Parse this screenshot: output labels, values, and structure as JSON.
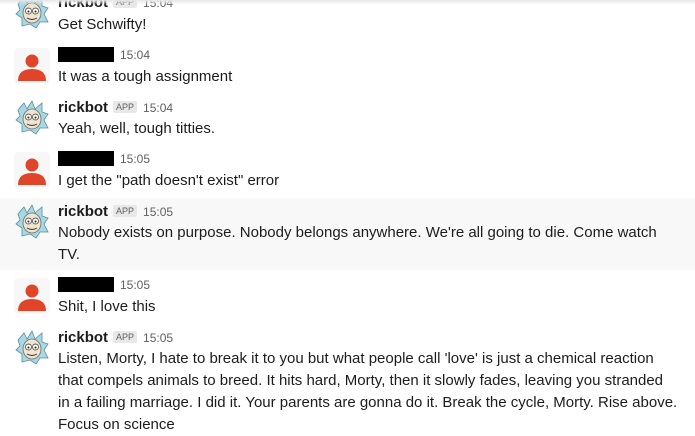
{
  "messages": [
    {
      "sender": "rickbot",
      "is_app": true,
      "badge": "APP",
      "time": "15:04",
      "text": "Get Schwifty!",
      "avatar": "rick-avatar"
    },
    {
      "sender": "",
      "redacted": true,
      "time": "15:04",
      "text": "It was a tough assignment",
      "avatar": "default-user-avatar"
    },
    {
      "sender": "rickbot",
      "is_app": true,
      "badge": "APP",
      "time": "15:04",
      "text": "Yeah, well, tough titties.",
      "avatar": "rick-avatar"
    },
    {
      "sender": "",
      "redacted": true,
      "time": "15:05",
      "text": "I get the \"path doesn't exist\" error",
      "avatar": "default-user-avatar"
    },
    {
      "sender": "rickbot",
      "is_app": true,
      "badge": "APP",
      "time": "15:05",
      "text": "Nobody exists on purpose. Nobody belongs anywhere. We're all going to die. Come watch TV.",
      "avatar": "rick-avatar",
      "hovered": true
    },
    {
      "sender": "",
      "redacted": true,
      "time": "15:05",
      "text": "Shit, I love this",
      "avatar": "default-user-avatar"
    },
    {
      "sender": "rickbot",
      "is_app": true,
      "badge": "APP",
      "time": "15:05",
      "text": "Listen, Morty, I hate to break it to you but what people call 'love' is just a chemical reaction that compels animals to breed. It hits hard, Morty, then it slowly fades, leaving you stranded in a failing marriage. I did it. Your parents are gonna do it. Break the cycle, Morty. Rise above. Focus on science",
      "avatar": "rick-avatar"
    }
  ],
  "colors": {
    "user_avatar": "#e0452a",
    "badge_bg": "#e8e8e8",
    "hover_bg": "#f8f8f8",
    "rick_hair": "#a7d8e6"
  }
}
